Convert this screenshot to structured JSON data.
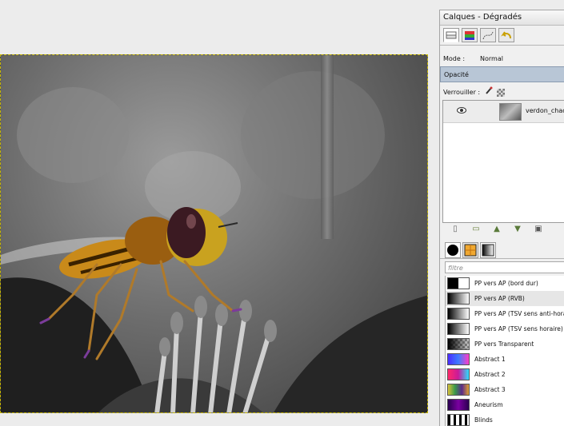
{
  "dock": {
    "title": "Calques - Dégradés",
    "mode_label": "Mode :",
    "mode_value": "Normal",
    "opacity_label": "Opacité",
    "lock_label": "Verrouiller :",
    "layers": [
      {
        "name": "verdon_chado",
        "visible": true
      }
    ],
    "filter_placeholder": "filtre",
    "gradients": [
      {
        "name": "PP vers AP (bord dur)",
        "selected": false
      },
      {
        "name": "PP vers AP (RVB)",
        "selected": true
      },
      {
        "name": "PP vers AP (TSV sens anti-horaire",
        "selected": false
      },
      {
        "name": "PP vers AP (TSV sens horaire)",
        "selected": false
      },
      {
        "name": "PP vers Transparent",
        "selected": false
      },
      {
        "name": "Abstract 1",
        "selected": false
      },
      {
        "name": "Abstract 2",
        "selected": false
      },
      {
        "name": "Abstract 3",
        "selected": false
      },
      {
        "name": "Aneurism",
        "selected": false
      },
      {
        "name": "Blinds",
        "selected": false
      }
    ]
  }
}
